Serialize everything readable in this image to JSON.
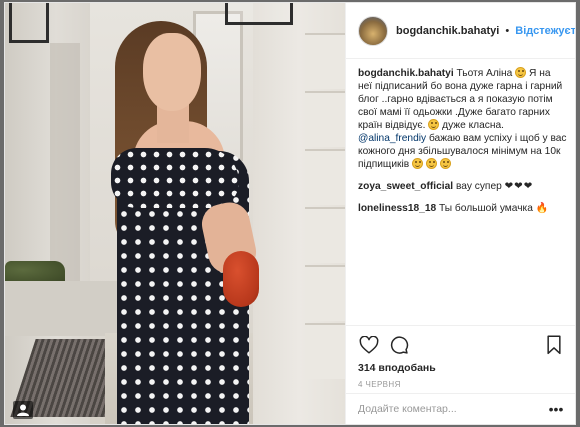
{
  "post": {
    "username": "bogdanchik.bahatyi",
    "separator": "•",
    "follow_label": "Відстежується"
  },
  "comments": [
    {
      "user": "bogdanchik.bahatyi",
      "text_1": "Тьотя Аліна",
      "text_2": "Я на неї підписаний бо вона дуже гарна і гарний блог ..гарно вдівається а я показую потім свої мамі її одьожки .Дуже багато гарних країн відвідує.",
      "text_3": "дуже класна.",
      "mention": "@alina_frendiy",
      "text_4": "бажаю вам успіху і щоб у вас кожного дня збільшувалося мінімум на 10к підпищиків"
    },
    {
      "user": "zoya_sweet_official",
      "text": "вау супер",
      "suffix": "❤❤❤"
    },
    {
      "user": "loneliness18_18",
      "text": "Ты большой умачка",
      "suffix": "🔥"
    }
  ],
  "actions": {
    "likes": "314 вподобань",
    "date": "4 червня"
  },
  "add_comment": {
    "placeholder": "Додайте коментар...",
    "more": "•••"
  },
  "icons": {
    "like": "heart-icon",
    "comment": "comment-icon",
    "save": "bookmark-icon",
    "carousel": "carousel-icon"
  }
}
